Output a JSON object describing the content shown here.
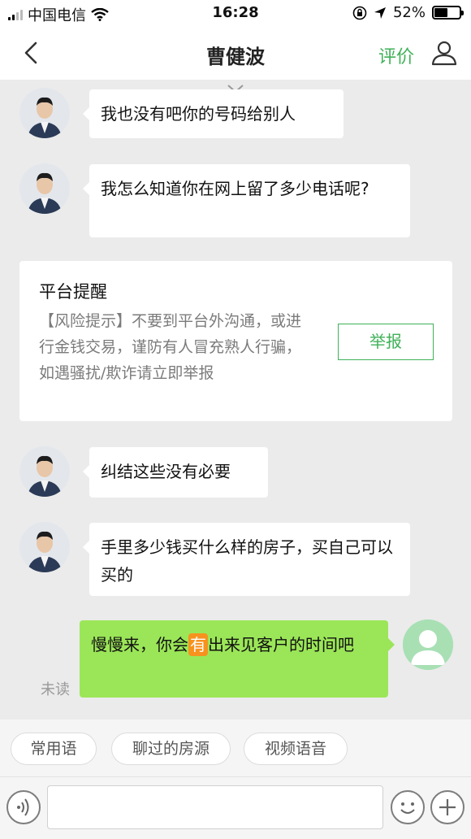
{
  "status_bar": {
    "carrier": "中国电信",
    "time": "16:28",
    "battery_text": "52%",
    "battery_level": 0.52,
    "icons": [
      "signal-icon",
      "wifi-icon",
      "orientation-lock-icon",
      "location-arrow-icon",
      "battery-icon"
    ]
  },
  "nav": {
    "title": "曹健波",
    "rate_label": "评价",
    "icons": [
      "back-chevron-icon",
      "user-icon",
      "chevron-down-icon"
    ]
  },
  "messages": [
    {
      "text": "我也没有吧你的号码给别人"
    },
    {
      "text": "我怎么知道你在网上留了多少电话呢?"
    },
    {
      "text": "纠结这些没有必要"
    },
    {
      "text": "手里多少钱买什么样的房子，买自己可以买的"
    }
  ],
  "platform_notice": {
    "title": "平台提醒",
    "body": "【风险提示】不要到平台外沟通，或进行金钱交易，谨防有人冒充熟人行骗，如遇骚扰/欺诈请立即举报",
    "report_label": "举报"
  },
  "my_message": {
    "text_before": "慢慢来，你会",
    "highlight": "有",
    "text_after": "出来见客户的时间吧",
    "status": "未读"
  },
  "quick_replies": [
    "常用语",
    "聊过的房源",
    "视频语音"
  ],
  "input_bar": {
    "placeholder": "",
    "icons": [
      "voice-icon",
      "emoji-icon",
      "plus-icon"
    ]
  },
  "colors": {
    "accent_green": "#3fb158",
    "my_bubble": "#9be658",
    "highlight_orange": "#f7921e",
    "chat_background": "#ebebeb"
  }
}
